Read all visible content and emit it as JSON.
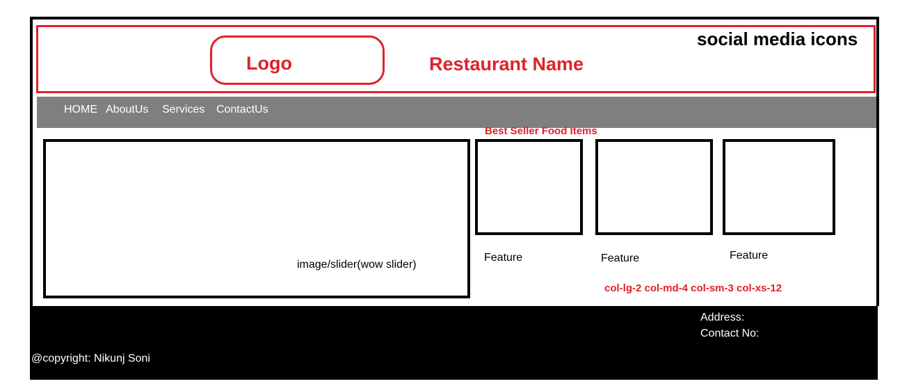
{
  "header": {
    "logo_label": "Logo",
    "restaurant_name": "Restaurant Name",
    "social_media": "social media icons"
  },
  "nav": {
    "items": [
      "HOME",
      "AboutUs",
      "Services",
      "ContactUs"
    ]
  },
  "main": {
    "slider_label": "image/slider(wow slider)",
    "best_seller_title": "Best Seller Food Items",
    "features": [
      "Feature",
      "Feature",
      "Feature"
    ],
    "grid_classes": "col-lg-2 col-md-4 col-sm-3 col-xs-12"
  },
  "footer": {
    "address": "Address:",
    "contact": "Contact No:",
    "copyright": "@copyright: Nikunj Soni"
  },
  "colors": {
    "accent_red": "#e0202a",
    "nav_gray": "#7f7f7f",
    "footer_black": "#000000"
  }
}
